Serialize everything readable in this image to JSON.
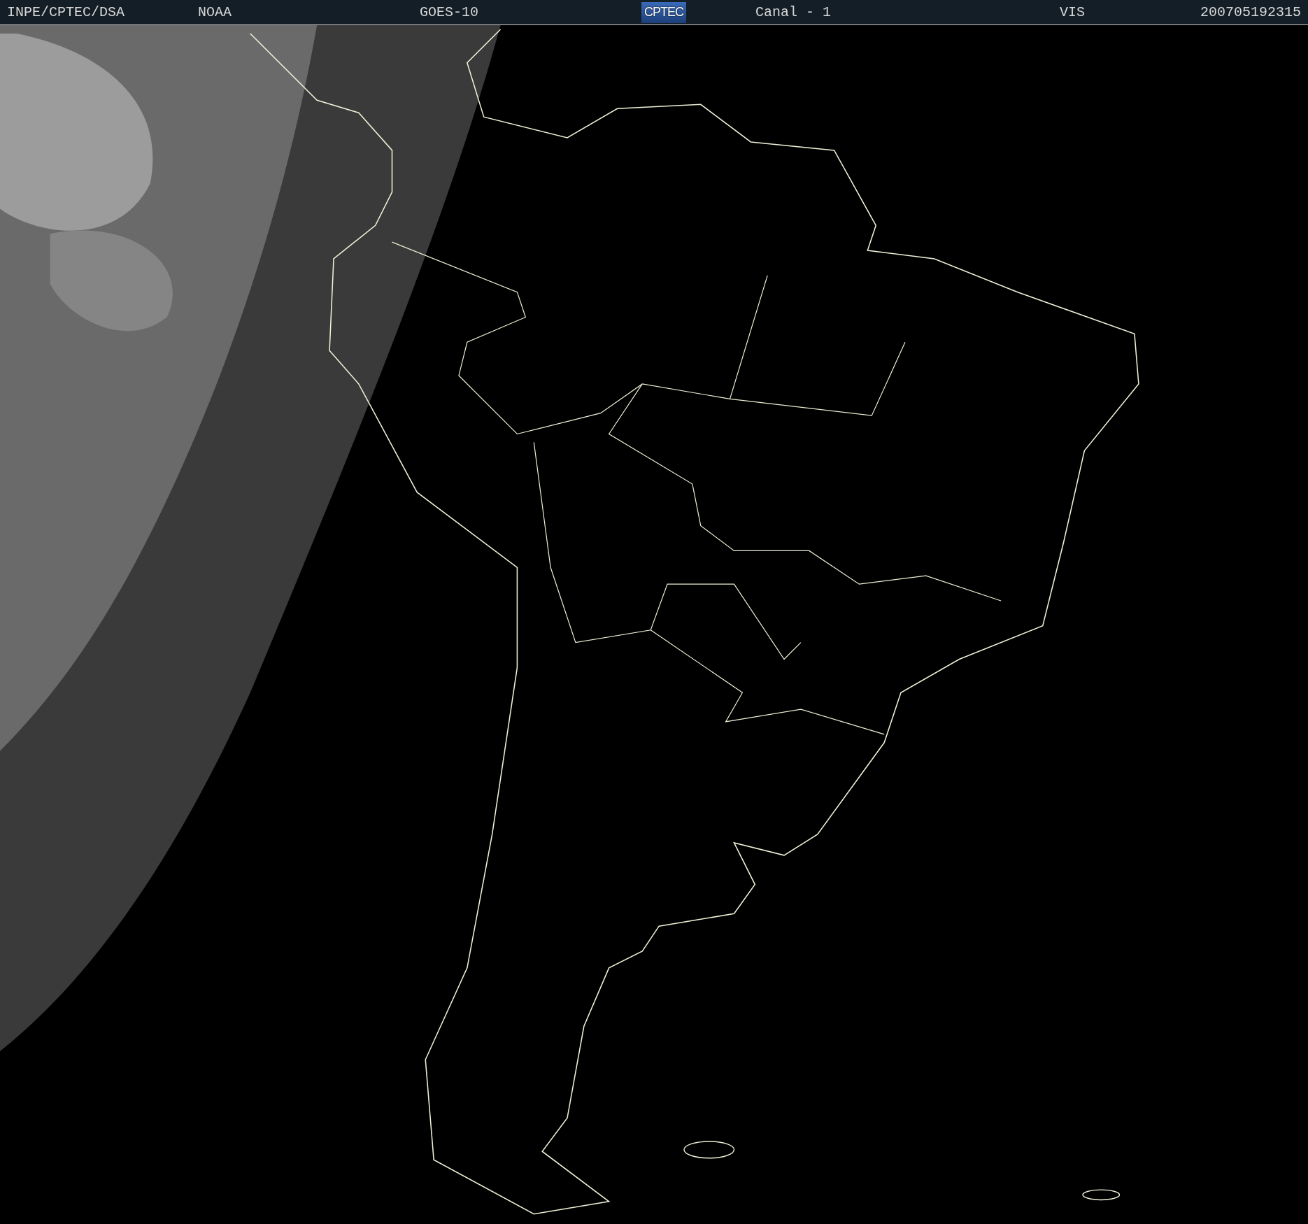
{
  "header": {
    "items": [
      {
        "kind": "text",
        "text": "INPE/CPTEC/DSA"
      },
      {
        "kind": "text",
        "text": "NOAA"
      },
      {
        "kind": "text",
        "text": "GOES-10"
      },
      {
        "kind": "logo",
        "text": "CPTEC"
      },
      {
        "kind": "text",
        "text": "Canal - 1"
      },
      {
        "kind": "text",
        "text": "VIS"
      },
      {
        "kind": "text",
        "text": "200705192315"
      }
    ]
  }
}
